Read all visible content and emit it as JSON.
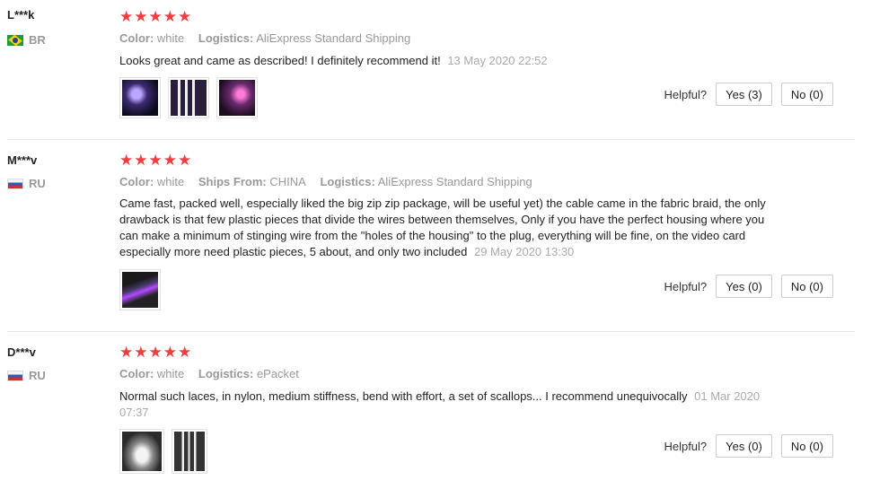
{
  "reviews": [
    {
      "user": "L***k",
      "country": "BR",
      "rating": 5,
      "attributes": [
        {
          "key": "Color:",
          "value": "white"
        },
        {
          "key": "Logistics:",
          "value": "AliExpress Standard Shipping"
        }
      ],
      "text": "Looks great and came as described! I definitely recommend it!",
      "date": "13 May 2020 22:52",
      "helpful_label": "Helpful?",
      "yes_label": "Yes (3)",
      "no_label": "No (0)"
    },
    {
      "user": "M***v",
      "country": "RU",
      "rating": 5,
      "attributes": [
        {
          "key": "Color:",
          "value": "white"
        },
        {
          "key": "Ships From:",
          "value": "CHINA"
        },
        {
          "key": "Logistics:",
          "value": "AliExpress Standard Shipping"
        }
      ],
      "text": "Came fast, packed well, especially liked the big zip zip package, will be useful yet) the cable came in the fabric braid, the only drawback is that few plastic pieces that divide the wires between themselves, Only if you have the perfect housing where you can make a minimum of stinging wire from the \"holes of the housing\" to the plug, everything will be fine, on the video card especially more need plastic pieces, 5 about, and only two included",
      "date": "29 May 2020 13:30",
      "helpful_label": "Helpful?",
      "yes_label": "Yes (0)",
      "no_label": "No (0)"
    },
    {
      "user": "D***v",
      "country": "RU",
      "rating": 5,
      "attributes": [
        {
          "key": "Color:",
          "value": "white"
        },
        {
          "key": "Logistics:",
          "value": "ePacket"
        }
      ],
      "text": "Normal such laces, in nylon, medium stiffness, bend with effort, a set of scallops... I recommend unequivocally",
      "date": "01 Mar 2020 07:37",
      "helpful_label": "Helpful?",
      "yes_label": "Yes (0)",
      "no_label": "No (0)"
    }
  ],
  "colors": {
    "star": "#f23d3d",
    "muted": "#999999",
    "separator": "#e8e8e8"
  },
  "icons": {
    "star": "star-icon",
    "flag_br": "brazil-flag-icon",
    "flag_ru": "russia-flag-icon"
  }
}
